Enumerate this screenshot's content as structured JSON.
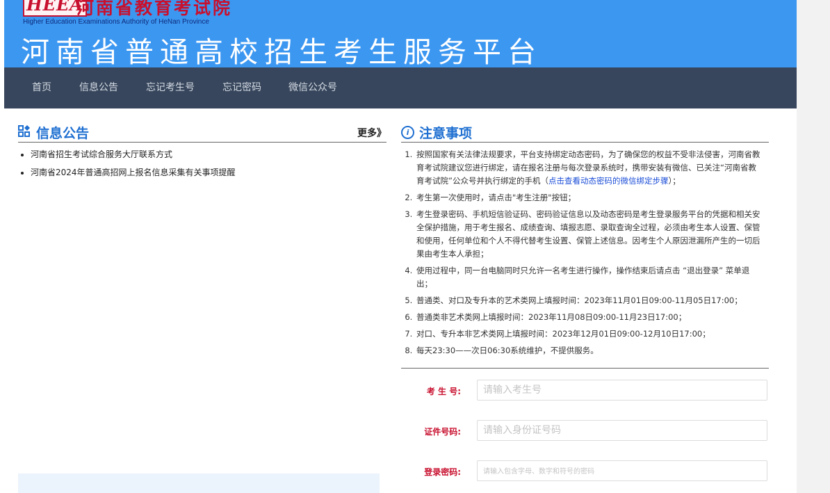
{
  "header": {
    "logo_text": "HEEA",
    "institution_cn": "河南省教育考试院",
    "institution_en": "Higher Education Examinations Authority of HeNan Province",
    "site_title": "河南省普通高校招生考生服务平台"
  },
  "nav": {
    "items": [
      {
        "label": "首页"
      },
      {
        "label": "信息公告"
      },
      {
        "label": "忘记考生号"
      },
      {
        "label": "忘记密码"
      },
      {
        "label": "微信公众号"
      }
    ]
  },
  "news": {
    "title": "信息公告",
    "more_label": "更多》",
    "items": [
      {
        "text": "河南省招生考试综合服务大厅联系方式"
      },
      {
        "text": "河南省2024年普通高招网上报名信息采集有关事项提醒"
      }
    ]
  },
  "notice": {
    "title": "注意事项",
    "items": [
      {
        "text": "按照国家有关法律法规要求，平台支持绑定动态密码，为了确保您的权益不受非法侵害，河南省教育考试院建议您进行绑定，请在报名注册与每次登录系统时，携带安装有微信、已关注“河南省教育考试院”公众号并执行绑定的手机（",
        "link": "点击查看动态密码的微信绑定步骤",
        "suffix": "）；"
      },
      {
        "text": "考生第一次使用时，请点击\"考生注册\"按钮；"
      },
      {
        "text": "考生登录密码、手机短信验证码、密码验证信息以及动态密码是考生登录服务平台的凭据和相关安全保护措施，用于考生报名、成绩查询、填报志愿、录取查询全过程，必须由考生本人设置、保管和使用，任何单位和个人不得代替考生设置、保管上述信息。因考生个人原因泄漏所产生的一切后果由考生本人承担；"
      },
      {
        "text": "使用过程中，同一台电脑同时只允许一名考生进行操作，操作结束后请点击 “退出登录” 菜单退出；"
      },
      {
        "text": "普通类、对口及专升本的艺术类网上填报时间：2023年11月01日09:00-11月05日17:00；"
      },
      {
        "text": "普通类非艺术类网上填报时间：2023年11月08日09:00-11月23日17:00；"
      },
      {
        "text": "对口、专升本非艺术类网上填报时间：2023年12月01日09:00-12月10日17:00；"
      },
      {
        "text": "每天23:30——次日06:30系统维护，不提供服务。"
      }
    ]
  },
  "form": {
    "exam_no_label": "考 生 号:",
    "exam_no_placeholder": "请输入考生号",
    "id_label": "证件号码:",
    "id_placeholder": "请输入身份证号码",
    "password_label": "登录密码:",
    "password_placeholder": "请输入包含字母、数字和符号的密码"
  },
  "colors": {
    "banner": "#3c97f1",
    "nav": "#37465c",
    "accent": "#1e6fd1",
    "label_red": "#c8102e"
  }
}
